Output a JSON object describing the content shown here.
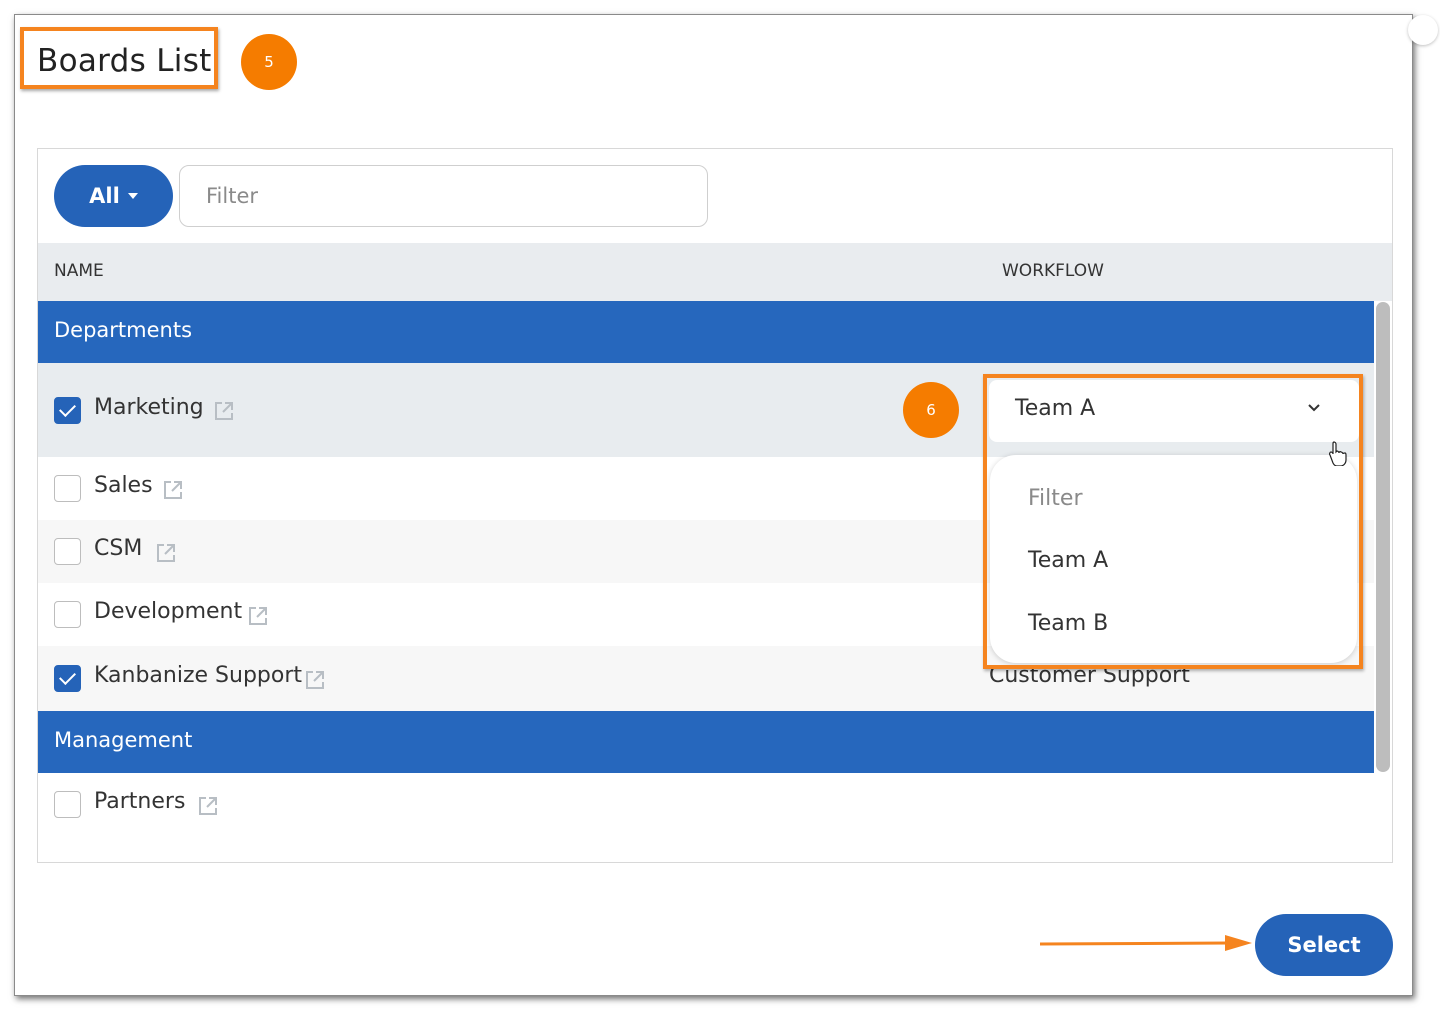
{
  "dialog": {
    "title": "Boards List",
    "step_badges": [
      "5",
      "6"
    ],
    "select_label": "Select"
  },
  "toolbar": {
    "scope_label": "All",
    "filter_placeholder": "Filter"
  },
  "table": {
    "headers": {
      "name": "NAME",
      "workflow": "WORKFLOW"
    },
    "groups": [
      {
        "label": "Departments",
        "rows": [
          {
            "name": "Marketing",
            "checked": true,
            "workflow": "Team A"
          },
          {
            "name": "Sales",
            "checked": false,
            "workflow": ""
          },
          {
            "name": "CSM",
            "checked": false,
            "workflow": ""
          },
          {
            "name": "Development",
            "checked": false,
            "workflow": ""
          },
          {
            "name": "Kanbanize Support",
            "checked": true,
            "workflow": "Customer Support"
          }
        ]
      },
      {
        "label": "Management",
        "rows": [
          {
            "name": "Partners",
            "checked": false,
            "workflow": ""
          }
        ]
      }
    ]
  },
  "workflow_dropdown": {
    "selected": "Team A",
    "filter_placeholder": "Filter",
    "options": [
      "Team A",
      "Team B"
    ]
  },
  "colors": {
    "primary": "#2563b8",
    "group_header": "#2667bd",
    "annotation_orange": "#f5841f"
  }
}
